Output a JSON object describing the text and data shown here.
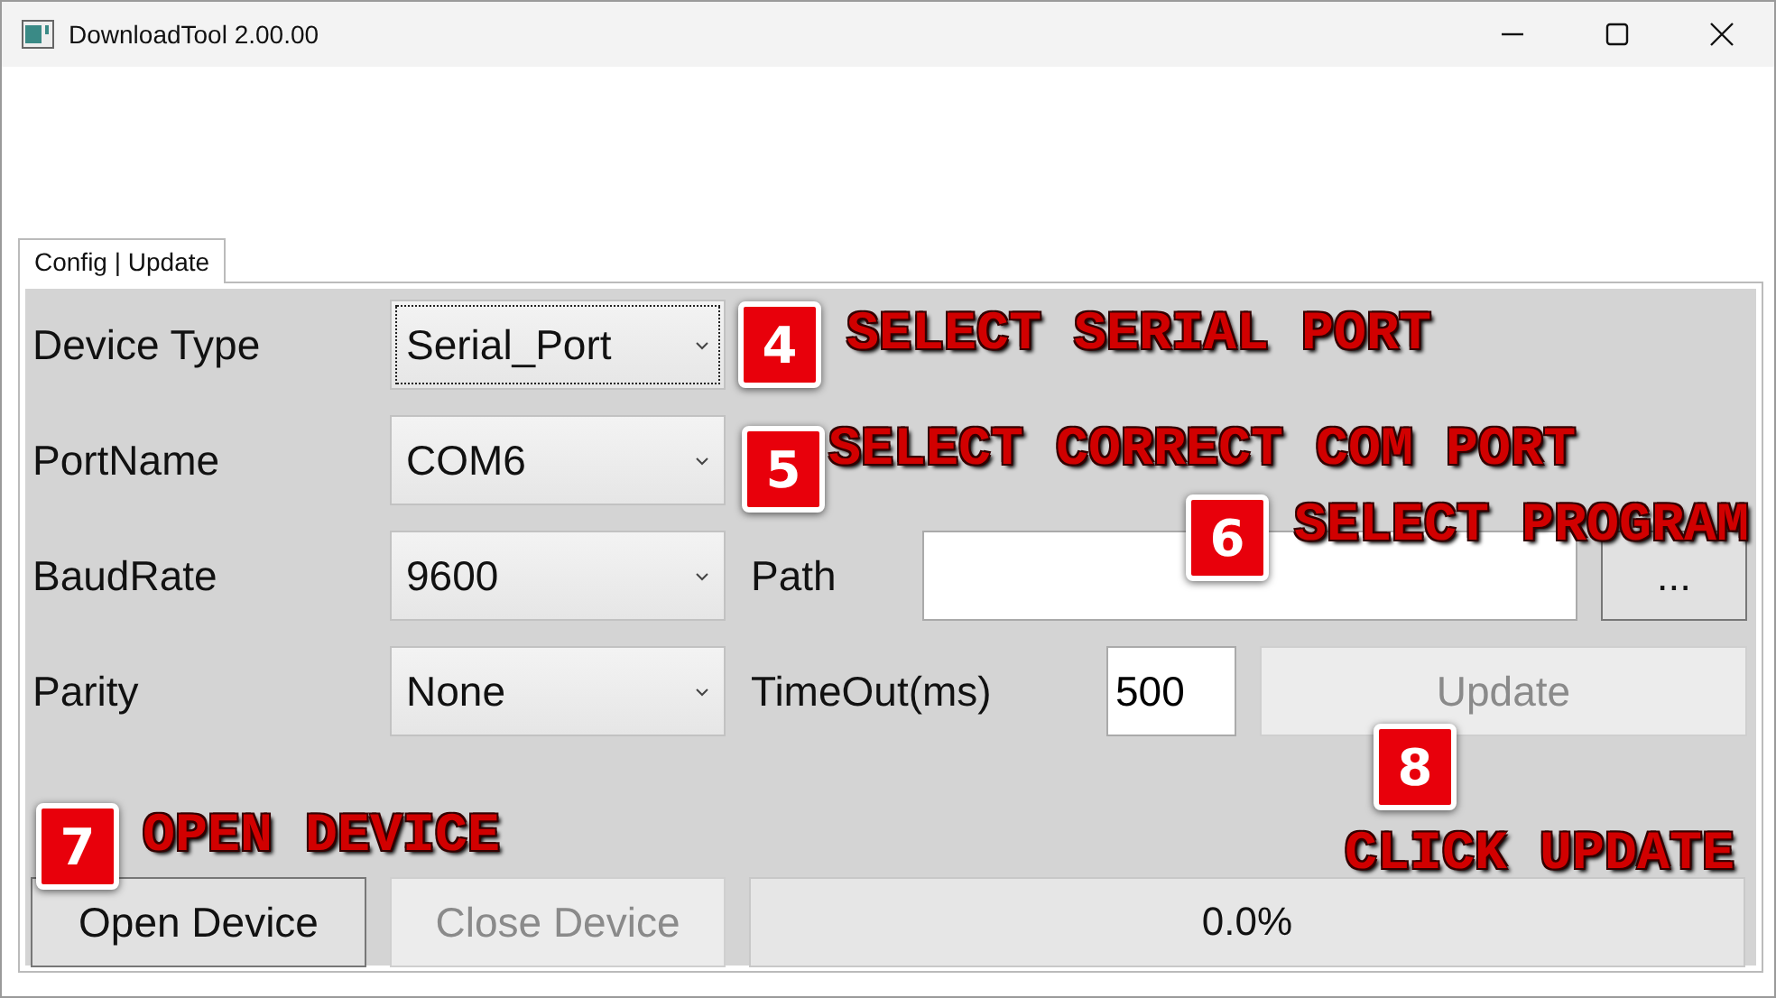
{
  "window": {
    "title": "DownloadTool 2.00.00"
  },
  "tabs": [
    {
      "label": "Config | Update",
      "selected": true
    }
  ],
  "settings": [
    {
      "label": "Device Type",
      "value": "Serial_Port",
      "focused": true
    },
    {
      "label": "PortName",
      "value": "COM6",
      "focused": false
    },
    {
      "label": "BaudRate",
      "value": "9600",
      "focused": false
    },
    {
      "label": "Parity",
      "value": "None",
      "focused": false
    }
  ],
  "path": {
    "label": "Path",
    "browse_button": "..."
  },
  "timeout": {
    "label": "TimeOut(ms)",
    "value": "500"
  },
  "update_button": {
    "label": "Update",
    "disabled": true
  },
  "open_button": {
    "label": "Open Device",
    "disabled": false
  },
  "close_button": {
    "label": "Close Device",
    "disabled": true
  },
  "progress": {
    "reading": "0.0%"
  },
  "annotations": [
    {
      "number": "4",
      "text": "SELECT SERIAL PORT"
    },
    {
      "number": "5",
      "text": "SELECT CORRECT COM PORT"
    },
    {
      "number": "6",
      "text": "SELECT PROGRAM"
    },
    {
      "number": "7",
      "text": "OPEN DEVICE"
    },
    {
      "number": "8",
      "text": "CLICK UPDATE"
    }
  ]
}
